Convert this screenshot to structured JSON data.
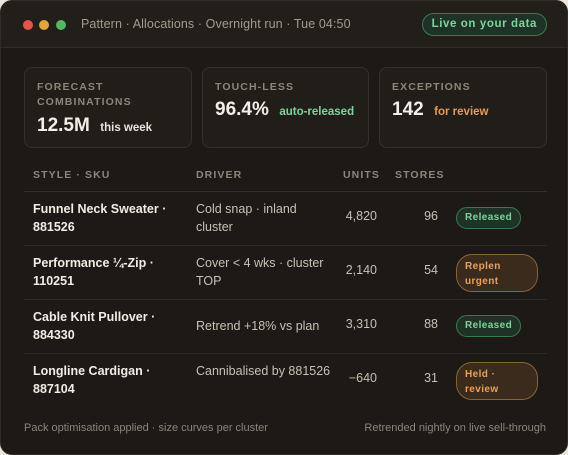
{
  "window": {
    "title": "Pattern · Allocations · Overnight run · Tue 04:50",
    "live_label": "Live on your data"
  },
  "kpis": [
    {
      "label": "Forecast combinations",
      "value": "12.5M",
      "note": "this week",
      "note_color": "#e9e4dc"
    },
    {
      "label": "Touch-less",
      "value": "96.4%",
      "note": "auto-released",
      "note_color": "#7fd49c"
    },
    {
      "label": "Exceptions",
      "value": "142",
      "note": "for review",
      "note_color": "#e69a55"
    }
  ],
  "table": {
    "headers": {
      "style": "Style · SKU",
      "driver": "Driver",
      "units": "Units",
      "stores": "Stores"
    },
    "rows": [
      {
        "style": "Funnel Neck Sweater · 881526",
        "driver": "Cold snap · inland cluster",
        "units": "4,820",
        "stores": "96",
        "status": "Released",
        "status_kind": "green"
      },
      {
        "style": "Performance ¼-Zip · 110251",
        "driver": "Cover < 4 wks · cluster TOP",
        "units": "2,140",
        "stores": "54",
        "status": "Replen urgent",
        "status_kind": "orange"
      },
      {
        "style": "Cable Knit Pullover · 884330",
        "driver": "Retrend +18% vs plan",
        "units": "3,310",
        "stores": "88",
        "status": "Released",
        "status_kind": "green"
      },
      {
        "style": "Longline Cardigan · 887104",
        "driver": "Cannibalised by 881526",
        "units": "−640",
        "stores": "31",
        "status": "Held · review",
        "status_kind": "orange"
      }
    ]
  },
  "footer": {
    "left": "Pack optimisation applied · size curves per cluster",
    "right": "Retrended nightly on live sell-through"
  },
  "colors": {
    "background": "#1c1916",
    "accent_green": "#7fd49c",
    "accent_orange": "#e69a55"
  }
}
